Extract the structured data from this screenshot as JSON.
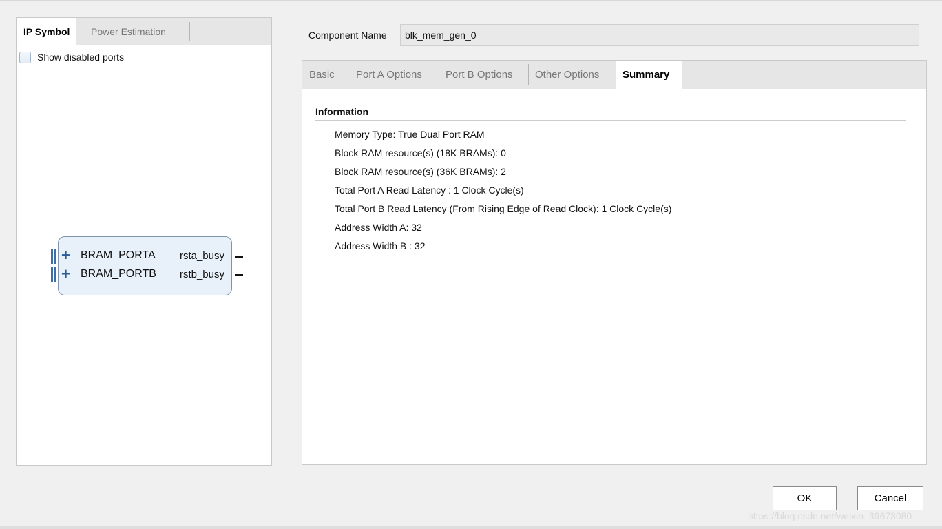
{
  "left_panel": {
    "tabs": [
      {
        "label": "IP Symbol",
        "active": true
      },
      {
        "label": "Power Estimation",
        "active": false
      }
    ],
    "show_disabled_ports": {
      "label": "Show disabled ports",
      "checked": false
    },
    "ip_symbol": {
      "ports": [
        {
          "name": "BRAM_PORTA",
          "output": "rsta_busy"
        },
        {
          "name": "BRAM_PORTB",
          "output": "rstb_busy"
        }
      ]
    }
  },
  "component": {
    "label": "Component Name",
    "value": "blk_mem_gen_0"
  },
  "right_panel": {
    "tabs": [
      {
        "label": "Basic",
        "active": false
      },
      {
        "label": "Port A Options",
        "active": false
      },
      {
        "label": "Port B Options",
        "active": false
      },
      {
        "label": "Other Options",
        "active": false
      },
      {
        "label": "Summary",
        "active": true
      }
    ],
    "section_title": "Information",
    "info_lines": [
      "Memory Type: True Dual Port RAM",
      "Block RAM resource(s) (18K BRAMs): 0",
      "Block RAM resource(s) (36K BRAMs): 2",
      "Total Port A Read Latency : 1 Clock Cycle(s)",
      "Total Port B Read Latency (From Rising Edge of Read Clock): 1 Clock Cycle(s)",
      "Address Width A: 32",
      "Address Width B : 32"
    ]
  },
  "buttons": {
    "ok": "OK",
    "cancel": "Cancel"
  },
  "watermark": "https://blog.csdn.net/weixin_39673080",
  "colors": {
    "accent_blue": "#2a5d99",
    "block_fill": "#e8f0f9",
    "panel_bg": "#f0f0f0"
  }
}
